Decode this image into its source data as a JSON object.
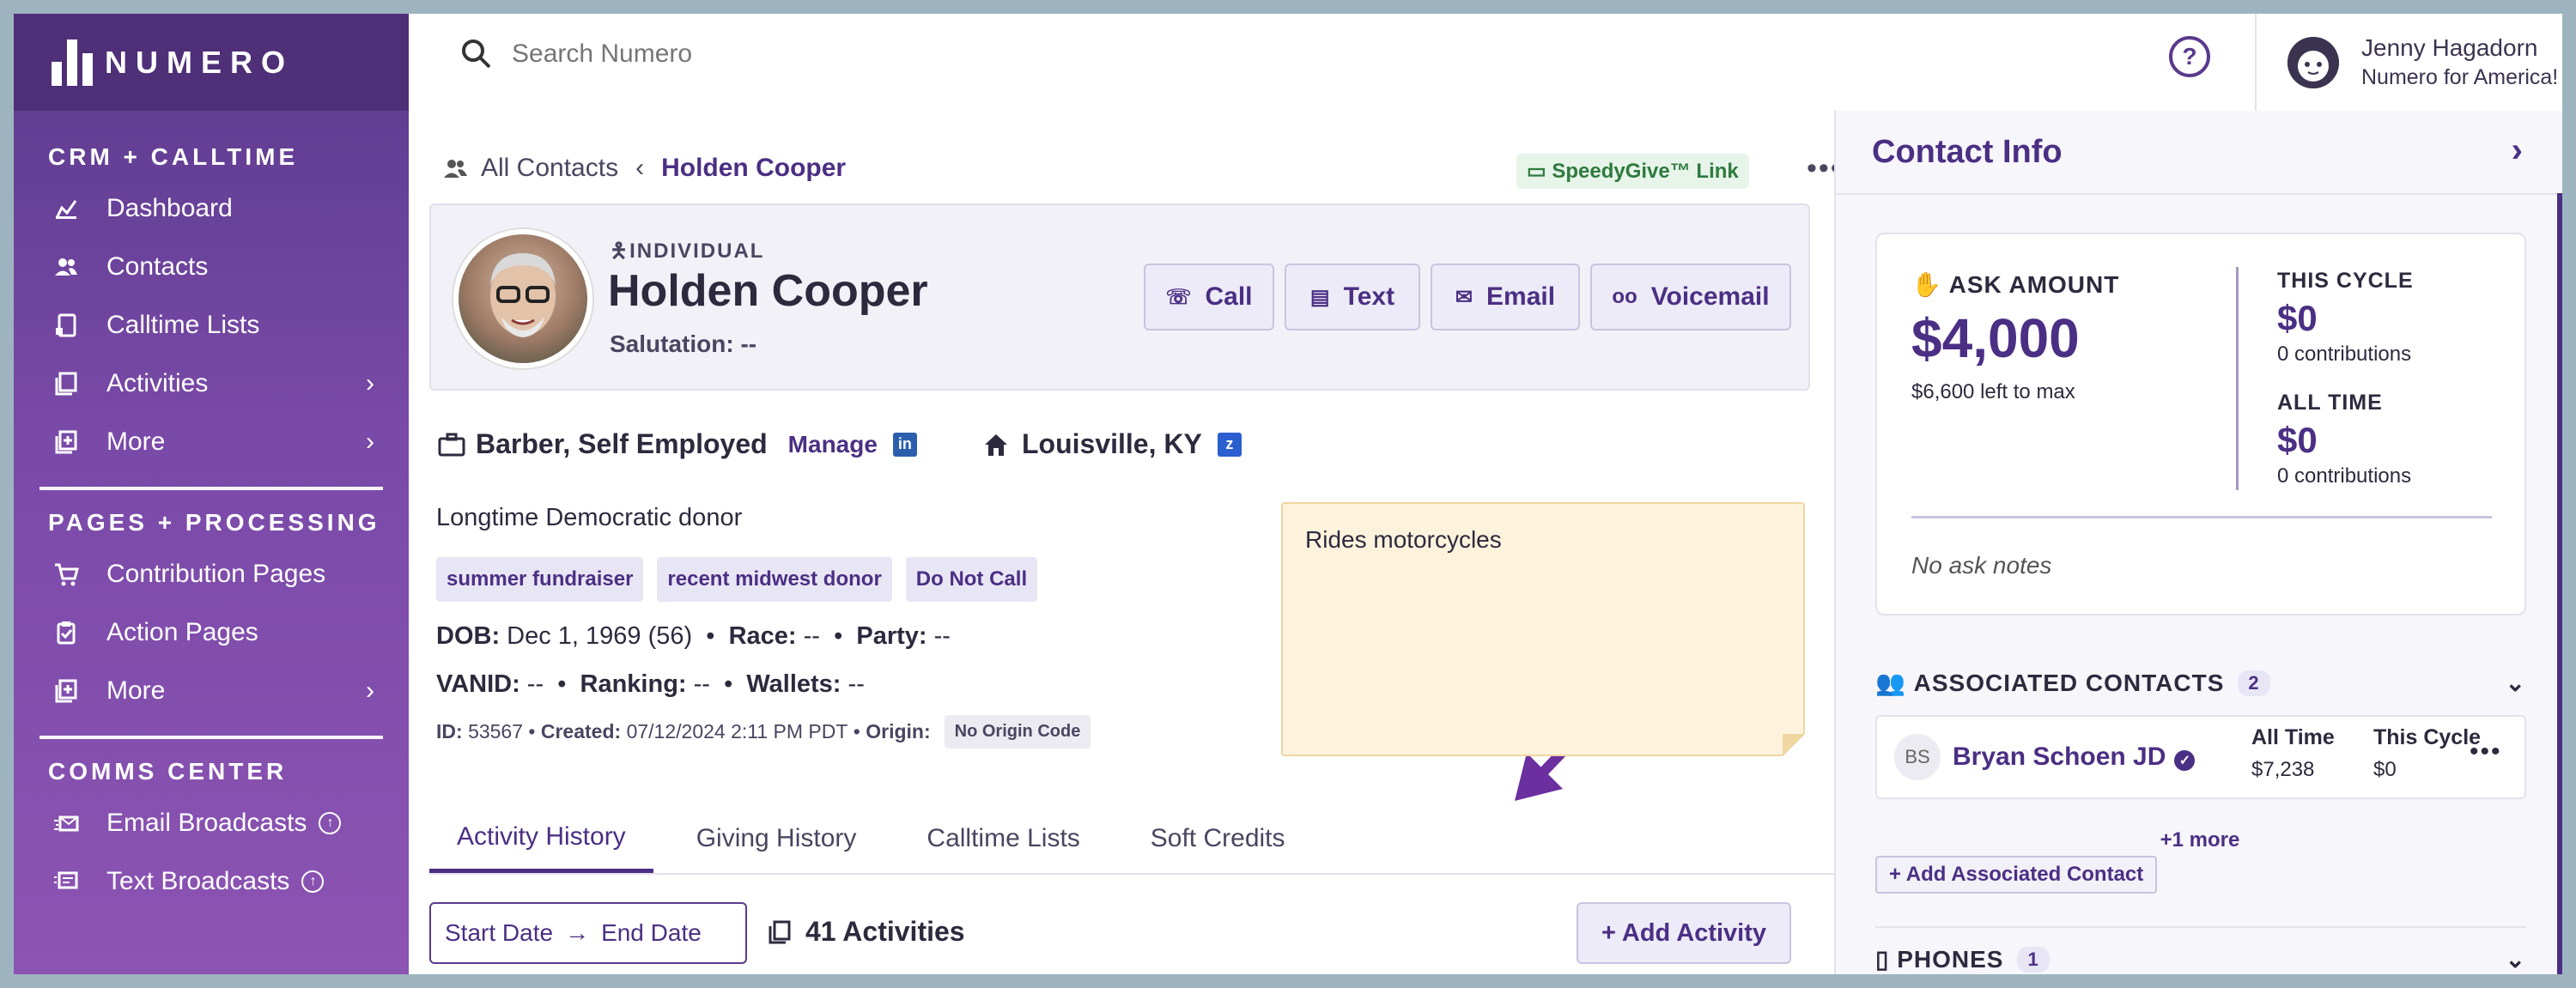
{
  "app": {
    "name": "NUMERO"
  },
  "sidebar": {
    "sections": [
      {
        "title": "CRM + CALLTIME",
        "items": [
          {
            "label": "Dashboard",
            "icon": "dashboard-icon"
          },
          {
            "label": "Contacts",
            "icon": "contacts-icon"
          },
          {
            "label": "Calltime Lists",
            "icon": "calltime-icon"
          },
          {
            "label": "Activities",
            "icon": "activities-icon"
          },
          {
            "label": "More",
            "icon": "more-icon"
          }
        ]
      },
      {
        "title": "PAGES + PROCESSING",
        "items": [
          {
            "label": "Contribution Pages",
            "icon": "cart-icon"
          },
          {
            "label": "Action Pages",
            "icon": "action-pages-icon"
          },
          {
            "label": "More",
            "icon": "more-icon"
          }
        ]
      },
      {
        "title": "COMMS CENTER",
        "items": [
          {
            "label": "Email Broadcasts",
            "icon": "email-broadcast-icon"
          },
          {
            "label": "Text Broadcasts",
            "icon": "text-broadcast-icon"
          }
        ]
      }
    ]
  },
  "topbar": {
    "search_placeholder": "Search Numero",
    "user_name": "Jenny Hagadorn",
    "user_org": "Numero for America!"
  },
  "breadcrumb": {
    "root": "All Contacts",
    "current": "Holden Cooper"
  },
  "speedygive_label": "SpeedyGive™ Link",
  "contact": {
    "type": "INDIVIDUAL",
    "name": "Holden Cooper",
    "salutation": "Salutation: --",
    "actions": {
      "call": "Call",
      "text": "Text",
      "email": "Email",
      "voicemail": "Voicemail"
    },
    "occupation": "Barber, Self Employed",
    "manage": "Manage",
    "location": "Louisville, KY",
    "description": "Longtime Democratic donor",
    "tags": [
      "summer fundraiser",
      "recent midwest donor",
      "Do Not Call"
    ],
    "dob_label": "DOB:",
    "dob": "Dec 1, 1969 (56)",
    "race_label": "Race:",
    "race": "--",
    "party_label": "Party:",
    "party": "--",
    "vanid_label": "VANID:",
    "vanid": "--",
    "ranking_label": "Ranking:",
    "ranking": "--",
    "wallets_label": "Wallets:",
    "wallets": "--",
    "id_label": "ID:",
    "id": "53567",
    "created_label": "Created:",
    "created": "07/12/2024 2:11 PM PDT",
    "origin_label": "Origin:",
    "origin": "No Origin Code",
    "note": "Rides motorcycles"
  },
  "tabs": [
    "Activity History",
    "Giving History",
    "Calltime Lists",
    "Soft Credits"
  ],
  "activity": {
    "start": "Start Date",
    "end": "End Date",
    "count": "41 Activities",
    "add": "+ Add Activity"
  },
  "panel": {
    "title": "Contact Info",
    "ask_label": "ASK AMOUNT",
    "ask_amount": "$4,000",
    "ask_left": "$6,600 left to max",
    "this_cycle_label": "THIS CYCLE",
    "this_cycle_value": "$0",
    "this_cycle_sub": "0 contributions",
    "all_time_label": "ALL TIME",
    "all_time_value": "$0",
    "all_time_sub": "0 contributions",
    "ask_notes": "No ask notes",
    "assoc_title": "ASSOCIATED CONTACTS",
    "assoc_count": "2",
    "assoc": {
      "initials": "BS",
      "name": "Bryan Schoen JD",
      "all_time_label": "All Time",
      "all_time": "$7,238",
      "this_cycle_label": "This Cycle",
      "this_cycle": "$0"
    },
    "more": "+1 more",
    "add_assoc": "+ Add Associated Contact",
    "phones_title": "PHONES",
    "phones_count": "1"
  },
  "colors": {
    "brand": "#4b2f84",
    "sidebar": "#7a4aa8",
    "note_bg": "#fdf3dd",
    "speedy_bg": "#e6f4ea"
  }
}
